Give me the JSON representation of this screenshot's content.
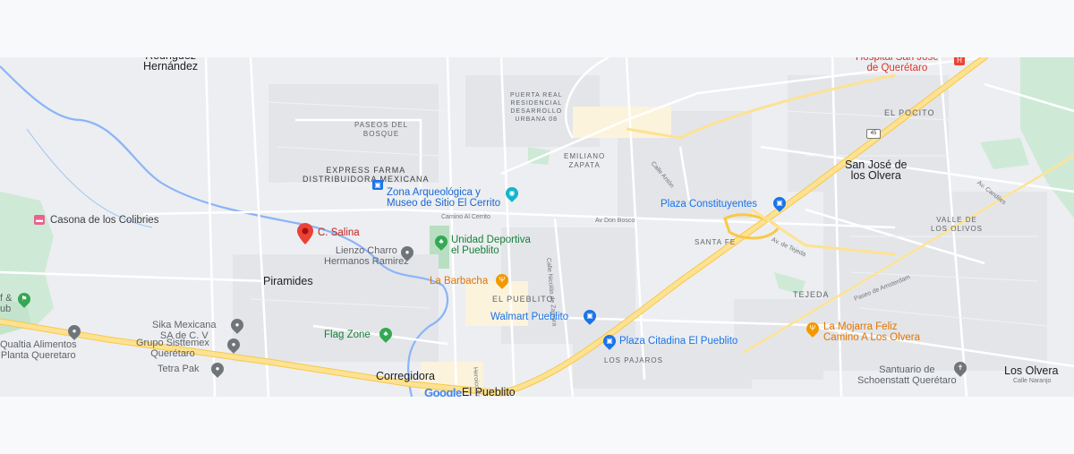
{
  "map": {
    "provider_logo": "Google",
    "marker": {
      "label": "C. Salina",
      "icon": "red-location-pin-icon",
      "color": "#ea4335"
    },
    "localities": {
      "rodriguez_hernandez": "Rodriguez\nHernández",
      "piramides": "Piramides",
      "corregidora": "Corregidora",
      "el_pueblito_bottom": "El Pueblito",
      "san_jose": "San José de\nlos Olvera",
      "los_olvera": "Los Olvera"
    },
    "neighborhoods": {
      "paseos_del_bosque": "PASEOS DEL\nBOSQUE",
      "puerta_real": "PUERTA REAL\nRESIDENCIAL\nDESARROLLO\nURBANA 08",
      "emiliano_zapata": "EMILIANO\nZAPATA",
      "el_pocito": "EL POCITO",
      "valle_olivos": "VALLE DE\nLOS OLIVOS",
      "santa_fe": "SANTA FE",
      "tejeda": "TEJEDA",
      "el_pueblito": "EL PUEBLITO",
      "los_pajaros": "LOS PAJAROS"
    },
    "streets": {
      "camino_cerrito": "Camino Al Cerrito",
      "av_don_bosco": "Av Don Bosco",
      "calle_naranjo": "Calle Naranjo",
      "paseo_amsterdam": "Paseo de Amsterdam",
      "av_tejeda": "Av. de Tejeda",
      "calle_anton": "Calle Antón",
      "calle_zamora": "Calle Nicolás de Zamora",
      "heroico": "Heroico Colegio Militar",
      "av_candiles": "Av. Candiles"
    },
    "highway_shield": "45",
    "pois": {
      "casona": "Casona de los Colibries",
      "express_farma": "EXPRESS FARMA\nDISTRIBUIDORA MEXICANA",
      "zona_arqueologica": "Zona Arqueológica y\nMuseo de Sitio El Cerrito",
      "lienzo_charro": "Lienzo Charro\nHermanos Ramirez",
      "unidad_deportiva": "Unidad Deportiva\nel Pueblito",
      "la_barbacha": "La Barbacha",
      "walmart": "Walmart Pueblito",
      "plaza_citadina": "Plaza Citadina El Pueblito",
      "plaza_constituyentes": "Plaza Constituyentes",
      "sika": "Sika Mexicana\nSA de C. V",
      "grupo_sisttemex": "Grupo Sisttemex\nQuerétaro",
      "tetra_pak": "Tetra Pak",
      "qualtia": "Qualtia Alimentos\nPlanta Queretaro",
      "flag_zone": "Flag Zone",
      "la_mojarra": "La Mojarra Feliz\nCamino A Los Olvera",
      "santuario": "Santuario de\nSchoenstatt Querétaro",
      "hospital": "Hospital San José\nde Querétaro",
      "club_fragment": "f &\nub"
    },
    "colors": {
      "land": "#eceef1",
      "road": "#ffffff",
      "highway": "#fde293",
      "highway_edge": "#f9c846",
      "park": "#ceead6",
      "river": "#8ab4f8",
      "shopping_blue": "#1a73e8",
      "recreation_green": "#34a853",
      "food_orange": "#f29900",
      "service_gray": "#70757a",
      "lodging_pink": "#e8638e"
    }
  }
}
